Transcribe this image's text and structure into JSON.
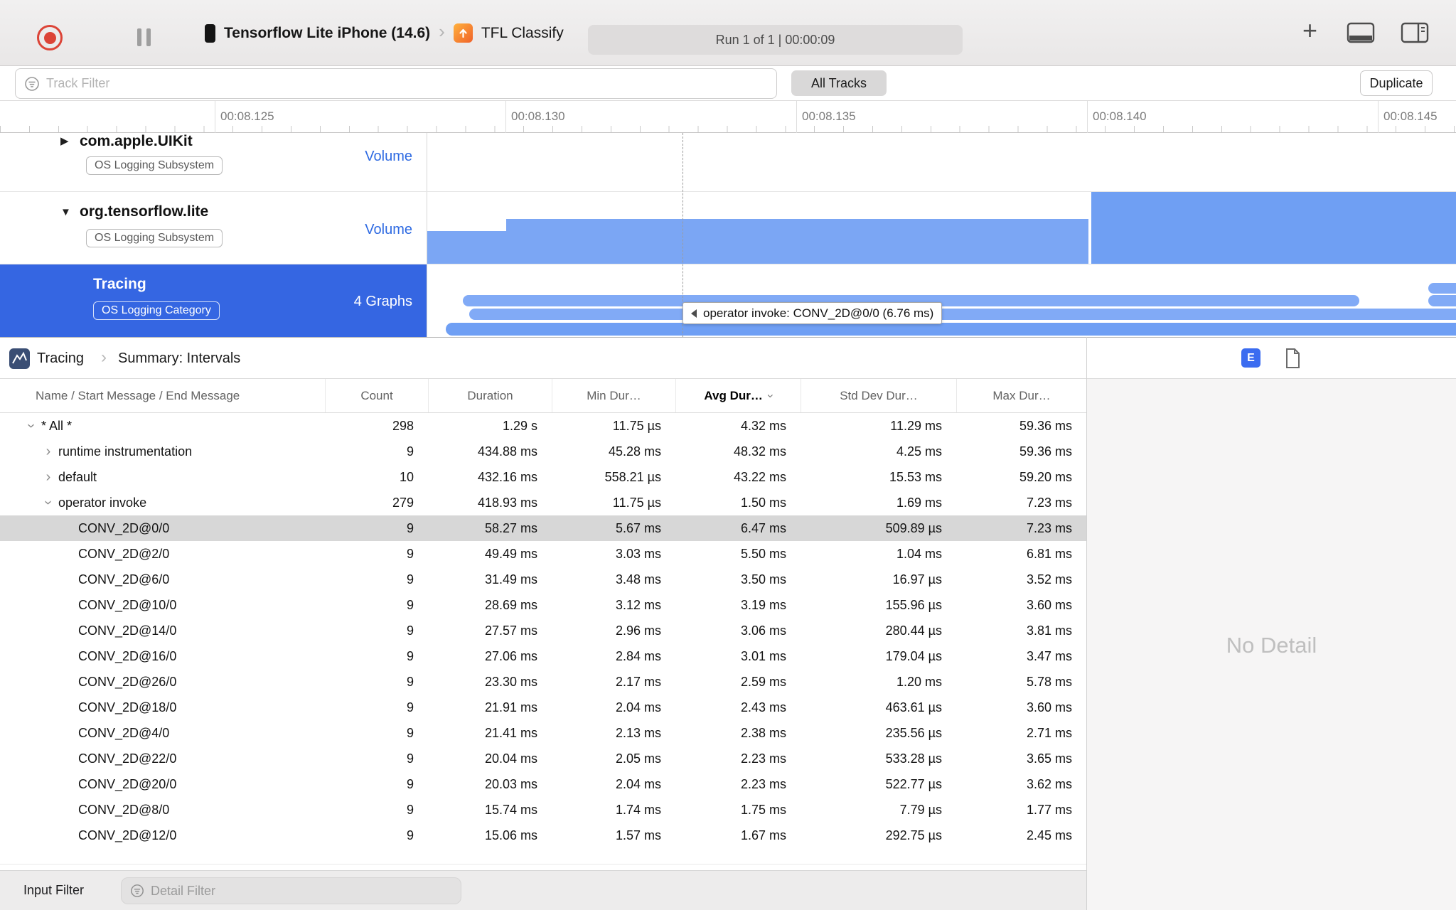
{
  "toolbar": {
    "device": "Tensorflow Lite iPhone (14.6)",
    "target": "TFL Classify",
    "run_status": "Run 1 of 1   |   00:00:09"
  },
  "filter_bar": {
    "track_filter_placeholder": "Track Filter",
    "all_tracks": "All Tracks",
    "duplicate": "Duplicate"
  },
  "ruler": {
    "labels": [
      "00:08.125",
      "00:08.130",
      "00:08.135",
      "00:08.140",
      "00:08.145"
    ]
  },
  "tracks": [
    {
      "name": "com.apple.UIKit",
      "badge": "OS Logging Subsystem",
      "meta": "Volume"
    },
    {
      "name": "org.tensorflow.lite",
      "badge": "OS Logging Subsystem",
      "meta": "Volume"
    },
    {
      "name": "Tracing",
      "badge": "OS Logging Category",
      "meta": "4 Graphs",
      "selected": true
    }
  ],
  "timeline": {
    "tooltip": "operator invoke: CONV_2D@0/0 (6.76 ms)"
  },
  "detail": {
    "breadcrumb_tool": "Tracing",
    "breadcrumb_view": "Summary: Intervals",
    "expanded_button": "E",
    "columns": [
      {
        "label": "Name / Start Message / End Message"
      },
      {
        "label": "Count"
      },
      {
        "label": "Duration"
      },
      {
        "label": "Min Dur…"
      },
      {
        "label": "Avg Dur…",
        "sorted": true
      },
      {
        "label": "Std Dev Dur…"
      },
      {
        "label": "Max Dur…"
      }
    ],
    "rows": [
      {
        "indent": 0,
        "disclosure": "open",
        "name": "* All *",
        "count": "298",
        "duration": "1.29 s",
        "min": "11.75 µs",
        "avg": "4.32 ms",
        "std": "11.29 ms",
        "max": "59.36 ms"
      },
      {
        "indent": 1,
        "disclosure": "closed",
        "name": "runtime instrumentation",
        "count": "9",
        "duration": "434.88 ms",
        "min": "45.28 ms",
        "avg": "48.32 ms",
        "std": "4.25 ms",
        "max": "59.36 ms"
      },
      {
        "indent": 1,
        "disclosure": "closed",
        "name": "default",
        "count": "10",
        "duration": "432.16 ms",
        "min": "558.21 µs",
        "avg": "43.22 ms",
        "std": "15.53 ms",
        "max": "59.20 ms"
      },
      {
        "indent": 1,
        "disclosure": "open",
        "name": "operator invoke",
        "count": "279",
        "duration": "418.93 ms",
        "min": "11.75 µs",
        "avg": "1.50 ms",
        "std": "1.69 ms",
        "max": "7.23 ms"
      },
      {
        "indent": 2,
        "name": "CONV_2D@0/0",
        "count": "9",
        "duration": "58.27 ms",
        "min": "5.67 ms",
        "avg": "6.47 ms",
        "std": "509.89 µs",
        "max": "7.23 ms",
        "selected": true
      },
      {
        "indent": 2,
        "name": "CONV_2D@2/0",
        "count": "9",
        "duration": "49.49 ms",
        "min": "3.03 ms",
        "avg": "5.50 ms",
        "std": "1.04 ms",
        "max": "6.81 ms"
      },
      {
        "indent": 2,
        "name": "CONV_2D@6/0",
        "count": "9",
        "duration": "31.49 ms",
        "min": "3.48 ms",
        "avg": "3.50 ms",
        "std": "16.97 µs",
        "max": "3.52 ms"
      },
      {
        "indent": 2,
        "name": "CONV_2D@10/0",
        "count": "9",
        "duration": "28.69 ms",
        "min": "3.12 ms",
        "avg": "3.19 ms",
        "std": "155.96 µs",
        "max": "3.60 ms"
      },
      {
        "indent": 2,
        "name": "CONV_2D@14/0",
        "count": "9",
        "duration": "27.57 ms",
        "min": "2.96 ms",
        "avg": "3.06 ms",
        "std": "280.44 µs",
        "max": "3.81 ms"
      },
      {
        "indent": 2,
        "name": "CONV_2D@16/0",
        "count": "9",
        "duration": "27.06 ms",
        "min": "2.84 ms",
        "avg": "3.01 ms",
        "std": "179.04 µs",
        "max": "3.47 ms"
      },
      {
        "indent": 2,
        "name": "CONV_2D@26/0",
        "count": "9",
        "duration": "23.30 ms",
        "min": "2.17 ms",
        "avg": "2.59 ms",
        "std": "1.20 ms",
        "max": "5.78 ms"
      },
      {
        "indent": 2,
        "name": "CONV_2D@18/0",
        "count": "9",
        "duration": "21.91 ms",
        "min": "2.04 ms",
        "avg": "2.43 ms",
        "std": "463.61 µs",
        "max": "3.60 ms"
      },
      {
        "indent": 2,
        "name": "CONV_2D@4/0",
        "count": "9",
        "duration": "21.41 ms",
        "min": "2.13 ms",
        "avg": "2.38 ms",
        "std": "235.56 µs",
        "max": "2.71 ms"
      },
      {
        "indent": 2,
        "name": "CONV_2D@22/0",
        "count": "9",
        "duration": "20.04 ms",
        "min": "2.05 ms",
        "avg": "2.23 ms",
        "std": "533.28 µs",
        "max": "3.65 ms"
      },
      {
        "indent": 2,
        "name": "CONV_2D@20/0",
        "count": "9",
        "duration": "20.03 ms",
        "min": "2.04 ms",
        "avg": "2.23 ms",
        "std": "522.77 µs",
        "max": "3.62 ms"
      },
      {
        "indent": 2,
        "name": "CONV_2D@8/0",
        "count": "9",
        "duration": "15.74 ms",
        "min": "1.74 ms",
        "avg": "1.75 ms",
        "std": "7.79 µs",
        "max": "1.77 ms"
      },
      {
        "indent": 2,
        "name": "CONV_2D@12/0",
        "count": "9",
        "duration": "15.06 ms",
        "min": "1.57 ms",
        "avg": "1.67 ms",
        "std": "292.75 µs",
        "max": "2.45 ms"
      }
    ],
    "no_detail": "No Detail",
    "input_filter_label": "Input Filter",
    "detail_filter_placeholder": "Detail Filter"
  }
}
